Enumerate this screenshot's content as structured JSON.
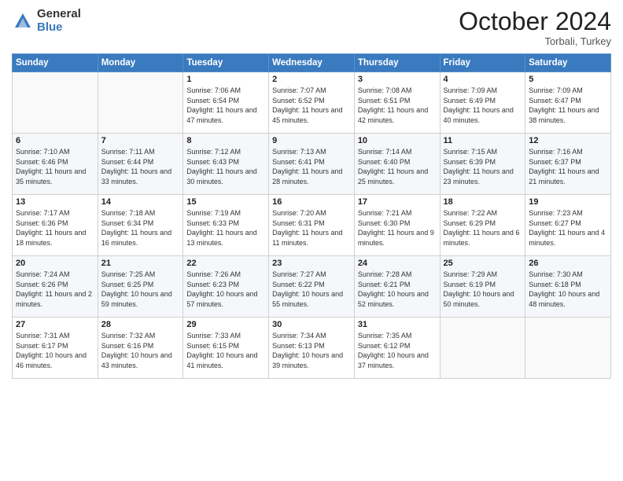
{
  "header": {
    "logo_general": "General",
    "logo_blue": "Blue",
    "month": "October 2024",
    "location": "Torbali, Turkey"
  },
  "days_of_week": [
    "Sunday",
    "Monday",
    "Tuesday",
    "Wednesday",
    "Thursday",
    "Friday",
    "Saturday"
  ],
  "weeks": [
    [
      {
        "day": "",
        "sunrise": "",
        "sunset": "",
        "daylight": ""
      },
      {
        "day": "",
        "sunrise": "",
        "sunset": "",
        "daylight": ""
      },
      {
        "day": "1",
        "sunrise": "Sunrise: 7:06 AM",
        "sunset": "Sunset: 6:54 PM",
        "daylight": "Daylight: 11 hours and 47 minutes."
      },
      {
        "day": "2",
        "sunrise": "Sunrise: 7:07 AM",
        "sunset": "Sunset: 6:52 PM",
        "daylight": "Daylight: 11 hours and 45 minutes."
      },
      {
        "day": "3",
        "sunrise": "Sunrise: 7:08 AM",
        "sunset": "Sunset: 6:51 PM",
        "daylight": "Daylight: 11 hours and 42 minutes."
      },
      {
        "day": "4",
        "sunrise": "Sunrise: 7:09 AM",
        "sunset": "Sunset: 6:49 PM",
        "daylight": "Daylight: 11 hours and 40 minutes."
      },
      {
        "day": "5",
        "sunrise": "Sunrise: 7:09 AM",
        "sunset": "Sunset: 6:47 PM",
        "daylight": "Daylight: 11 hours and 38 minutes."
      }
    ],
    [
      {
        "day": "6",
        "sunrise": "Sunrise: 7:10 AM",
        "sunset": "Sunset: 6:46 PM",
        "daylight": "Daylight: 11 hours and 35 minutes."
      },
      {
        "day": "7",
        "sunrise": "Sunrise: 7:11 AM",
        "sunset": "Sunset: 6:44 PM",
        "daylight": "Daylight: 11 hours and 33 minutes."
      },
      {
        "day": "8",
        "sunrise": "Sunrise: 7:12 AM",
        "sunset": "Sunset: 6:43 PM",
        "daylight": "Daylight: 11 hours and 30 minutes."
      },
      {
        "day": "9",
        "sunrise": "Sunrise: 7:13 AM",
        "sunset": "Sunset: 6:41 PM",
        "daylight": "Daylight: 11 hours and 28 minutes."
      },
      {
        "day": "10",
        "sunrise": "Sunrise: 7:14 AM",
        "sunset": "Sunset: 6:40 PM",
        "daylight": "Daylight: 11 hours and 25 minutes."
      },
      {
        "day": "11",
        "sunrise": "Sunrise: 7:15 AM",
        "sunset": "Sunset: 6:39 PM",
        "daylight": "Daylight: 11 hours and 23 minutes."
      },
      {
        "day": "12",
        "sunrise": "Sunrise: 7:16 AM",
        "sunset": "Sunset: 6:37 PM",
        "daylight": "Daylight: 11 hours and 21 minutes."
      }
    ],
    [
      {
        "day": "13",
        "sunrise": "Sunrise: 7:17 AM",
        "sunset": "Sunset: 6:36 PM",
        "daylight": "Daylight: 11 hours and 18 minutes."
      },
      {
        "day": "14",
        "sunrise": "Sunrise: 7:18 AM",
        "sunset": "Sunset: 6:34 PM",
        "daylight": "Daylight: 11 hours and 16 minutes."
      },
      {
        "day": "15",
        "sunrise": "Sunrise: 7:19 AM",
        "sunset": "Sunset: 6:33 PM",
        "daylight": "Daylight: 11 hours and 13 minutes."
      },
      {
        "day": "16",
        "sunrise": "Sunrise: 7:20 AM",
        "sunset": "Sunset: 6:31 PM",
        "daylight": "Daylight: 11 hours and 11 minutes."
      },
      {
        "day": "17",
        "sunrise": "Sunrise: 7:21 AM",
        "sunset": "Sunset: 6:30 PM",
        "daylight": "Daylight: 11 hours and 9 minutes."
      },
      {
        "day": "18",
        "sunrise": "Sunrise: 7:22 AM",
        "sunset": "Sunset: 6:29 PM",
        "daylight": "Daylight: 11 hours and 6 minutes."
      },
      {
        "day": "19",
        "sunrise": "Sunrise: 7:23 AM",
        "sunset": "Sunset: 6:27 PM",
        "daylight": "Daylight: 11 hours and 4 minutes."
      }
    ],
    [
      {
        "day": "20",
        "sunrise": "Sunrise: 7:24 AM",
        "sunset": "Sunset: 6:26 PM",
        "daylight": "Daylight: 11 hours and 2 minutes."
      },
      {
        "day": "21",
        "sunrise": "Sunrise: 7:25 AM",
        "sunset": "Sunset: 6:25 PM",
        "daylight": "Daylight: 10 hours and 59 minutes."
      },
      {
        "day": "22",
        "sunrise": "Sunrise: 7:26 AM",
        "sunset": "Sunset: 6:23 PM",
        "daylight": "Daylight: 10 hours and 57 minutes."
      },
      {
        "day": "23",
        "sunrise": "Sunrise: 7:27 AM",
        "sunset": "Sunset: 6:22 PM",
        "daylight": "Daylight: 10 hours and 55 minutes."
      },
      {
        "day": "24",
        "sunrise": "Sunrise: 7:28 AM",
        "sunset": "Sunset: 6:21 PM",
        "daylight": "Daylight: 10 hours and 52 minutes."
      },
      {
        "day": "25",
        "sunrise": "Sunrise: 7:29 AM",
        "sunset": "Sunset: 6:19 PM",
        "daylight": "Daylight: 10 hours and 50 minutes."
      },
      {
        "day": "26",
        "sunrise": "Sunrise: 7:30 AM",
        "sunset": "Sunset: 6:18 PM",
        "daylight": "Daylight: 10 hours and 48 minutes."
      }
    ],
    [
      {
        "day": "27",
        "sunrise": "Sunrise: 7:31 AM",
        "sunset": "Sunset: 6:17 PM",
        "daylight": "Daylight: 10 hours and 46 minutes."
      },
      {
        "day": "28",
        "sunrise": "Sunrise: 7:32 AM",
        "sunset": "Sunset: 6:16 PM",
        "daylight": "Daylight: 10 hours and 43 minutes."
      },
      {
        "day": "29",
        "sunrise": "Sunrise: 7:33 AM",
        "sunset": "Sunset: 6:15 PM",
        "daylight": "Daylight: 10 hours and 41 minutes."
      },
      {
        "day": "30",
        "sunrise": "Sunrise: 7:34 AM",
        "sunset": "Sunset: 6:13 PM",
        "daylight": "Daylight: 10 hours and 39 minutes."
      },
      {
        "day": "31",
        "sunrise": "Sunrise: 7:35 AM",
        "sunset": "Sunset: 6:12 PM",
        "daylight": "Daylight: 10 hours and 37 minutes."
      },
      {
        "day": "",
        "sunrise": "",
        "sunset": "",
        "daylight": ""
      },
      {
        "day": "",
        "sunrise": "",
        "sunset": "",
        "daylight": ""
      }
    ]
  ]
}
